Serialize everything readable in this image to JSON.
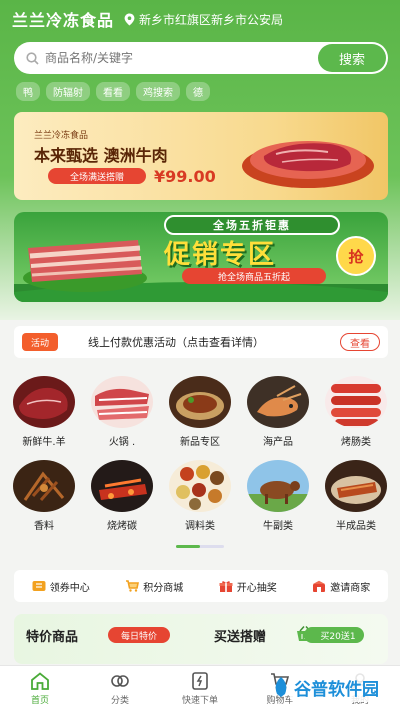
{
  "header": {
    "shop_name": "兰兰冷冻食品",
    "location": "新乡市红旗区新乡市公安局"
  },
  "search": {
    "placeholder": "商品名称/关键字",
    "button": "搜索"
  },
  "hot_tags": [
    "鸭",
    "防辐射",
    "看看",
    "鸡搜索",
    "德"
  ],
  "banner1": {
    "brand": "兰兰冷冻食品",
    "title": "本来甄选 澳洲牛肉",
    "button": "全场满送搭赠",
    "price": "¥99.00"
  },
  "banner2": {
    "ribbon": "全场五折钜惠",
    "title": "促销专区",
    "subtitle": "抢全场商品五折起",
    "grab": "抢"
  },
  "notice": {
    "badge": "活动",
    "text": "线上付款优惠活动（点击查看详情）",
    "button": "查看"
  },
  "categories": [
    {
      "label": "新鲜牛.羊",
      "icon": "beef-icon"
    },
    {
      "label": "火锅 .",
      "icon": "hotpot-icon"
    },
    {
      "label": "新品专区",
      "icon": "new-dish-icon"
    },
    {
      "label": "海产品",
      "icon": "seafood-icon"
    },
    {
      "label": "烤肠类",
      "icon": "sausage-icon"
    },
    {
      "label": "香料",
      "icon": "spice-icon"
    },
    {
      "label": "烧烤碳",
      "icon": "charcoal-icon"
    },
    {
      "label": "调料类",
      "icon": "seasoning-icon"
    },
    {
      "label": "牛副类",
      "icon": "cattle-icon"
    },
    {
      "label": "半成品类",
      "icon": "semi-food-icon"
    }
  ],
  "pager": {
    "page_fraction": 0.5
  },
  "shortcuts": [
    {
      "label": "领券中心",
      "icon": "coupon-icon"
    },
    {
      "label": "积分商城",
      "icon": "points-cart-icon"
    },
    {
      "label": "开心抽奖",
      "icon": "gift-icon"
    },
    {
      "label": "邀请商家",
      "icon": "invite-icon"
    }
  ],
  "specials": {
    "title": "特价商品",
    "badge": "每日特价",
    "title2": "买送搭赠",
    "badge2": "买20送1"
  },
  "tabbar": [
    {
      "label": "首页",
      "icon": "home-icon",
      "active": true
    },
    {
      "label": "分类",
      "icon": "category-icon",
      "active": false
    },
    {
      "label": "快速下单",
      "icon": "quick-order-icon",
      "active": false
    },
    {
      "label": "购物车",
      "icon": "cart-icon",
      "active": false
    },
    {
      "label": "我的",
      "icon": "user-icon",
      "active": false
    }
  ],
  "watermark": "谷普软件园",
  "colors": {
    "brand_green": "#5cb84c",
    "accent_red": "#e64532"
  }
}
